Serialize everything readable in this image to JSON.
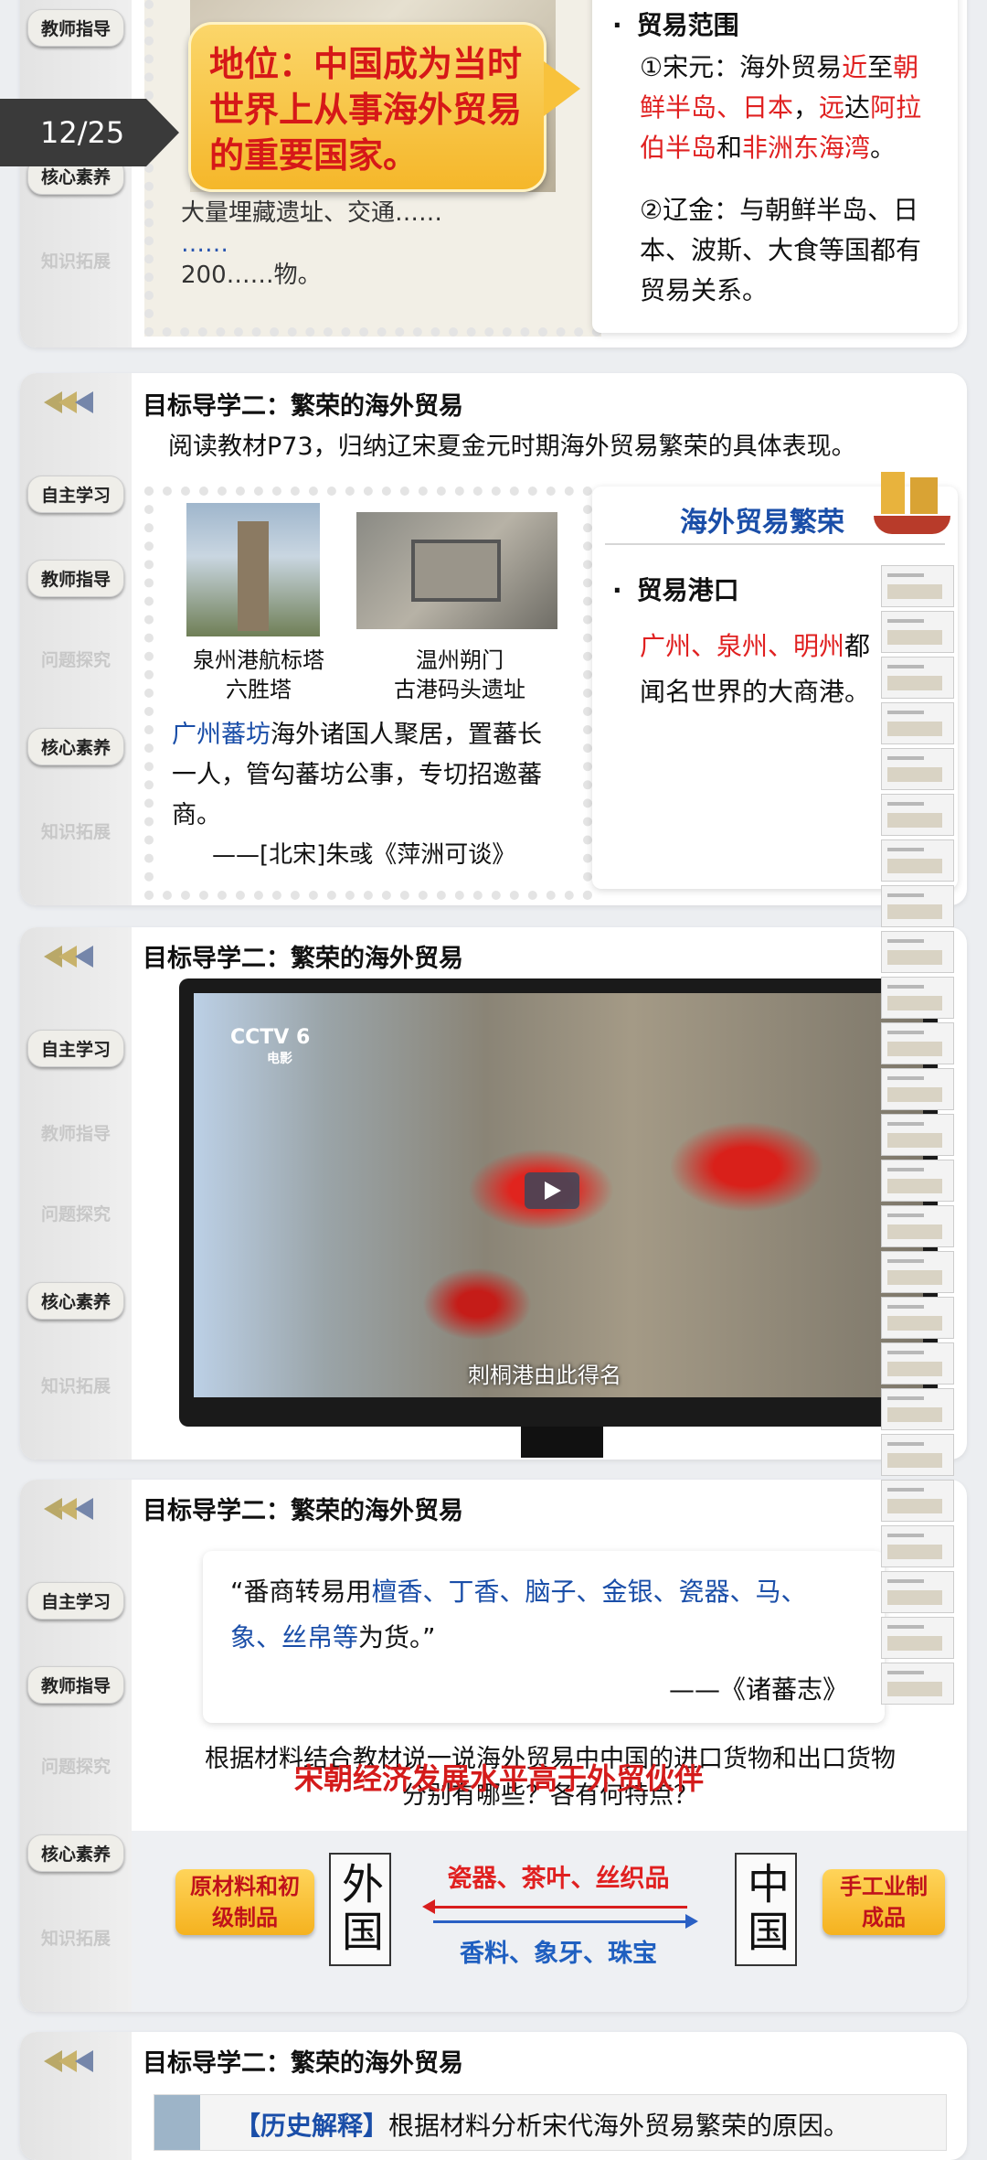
{
  "page_indicator": "12/25",
  "nav": {
    "self_study": "自主学习",
    "teacher_guide": "教师指导",
    "inquiry": "问题探究",
    "core": "核心素养",
    "extension": "知识拓展"
  },
  "slide1": {
    "callout": "地位：中国成为当时世界上从事海外贸易的重要国家。",
    "stamp_text_line1": "大量埋藏遗址、交通……",
    "stamp_text_line2": "200……物。",
    "range_title": "贸易范围",
    "song_prefix": "①宋元：海外贸易",
    "song_near": "近",
    "song_to": "至",
    "song_red1": "朝鲜半岛、日本",
    "song_comma": "，",
    "song_far": "远",
    "song_reach": "达",
    "song_red2": "阿拉伯半岛",
    "song_and": "和",
    "song_red3": "非洲东海湾",
    "song_end": "。",
    "liao": "②辽金：与朝鲜半岛、日本、波斯、大食等国都有贸易关系。"
  },
  "slide2": {
    "title": "目标导学二：繁荣的海外贸易",
    "instruction": "阅读教材P73，归纳辽宋夏金元时期海外贸易繁荣的具体表现。",
    "img1_caption_1": "泉州港航标塔",
    "img1_caption_2": "六胜塔",
    "img2_caption_1": "温州朔门",
    "img2_caption_2": "古港码头遗址",
    "quote_blue": "广州蕃坊",
    "quote_rest": "海外诸国人聚居，置蕃长一人，管勾蕃坊公事，专切招邀蕃商。",
    "quote_source": "——[北宋]朱彧《萍洲可谈》",
    "banner": "海外贸易繁荣",
    "port_title": "贸易港口",
    "ports_red": "广州、泉州、明州",
    "ports_rest1": "都",
    "ports_rest2": "闻名世界的大商港。"
  },
  "slide3": {
    "title": "目标导学二：繁荣的海外贸易",
    "channel": "CCTV 6",
    "channel_sub": "电影",
    "subtitle": "刺桐港由此得名"
  },
  "slide4": {
    "title": "目标导学二：繁荣的海外贸易",
    "quote_open": "“番商转易用",
    "quote_blue1": "檀香、丁香、脑子、金银、瓷器、马、",
    "quote_blue2": "象、丝帛等",
    "quote_close": "为货。”",
    "quote_source": "——《诸蕃志》",
    "question": "根据材料结合教材说一说海外贸易中中国的进口货物和出口货物分别有哪些？各有何特点？",
    "overlay": "宋朝经济发展水平高于外贸伙伴",
    "left_tag": "原材料和初级制品",
    "foreign": "外国",
    "china": "中国",
    "right_tag": "手工业制成品",
    "export_goods": "瓷器、茶叶、丝织品",
    "import_goods": "香料、象牙、珠宝"
  },
  "slide5": {
    "title": "目标导学二：繁荣的海外贸易",
    "label": "【历史解释】",
    "text": "根据材料分析宋代海外贸易繁荣的原因。"
  },
  "colors": {
    "red": "#e02020",
    "blue": "#1a4ea8",
    "callout_bg": "#f8c23c"
  }
}
